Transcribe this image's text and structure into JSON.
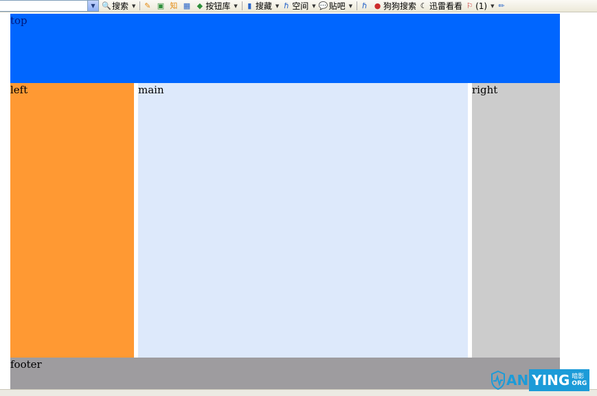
{
  "toolbar": {
    "search_label": "搜索",
    "buttons_label": "按钮库",
    "collect_label": "搜藏",
    "space_label": "空间",
    "tieba_label": "贴吧",
    "sogou_label": "狗狗搜索",
    "xunlei_label": "迅雷看看",
    "count_label": "(1)",
    "zhidao_label": "知"
  },
  "layout": {
    "top_label": "top",
    "left_label": "left",
    "main_label": "main",
    "right_label": "right",
    "footer_label": "footer"
  },
  "watermark": {
    "part1": "AN",
    "part2": "YING",
    "cn": "暗影",
    "org": "ORG"
  },
  "colors": {
    "top": "#0066ff",
    "left": "#ff9933",
    "main": "#dde9fb",
    "right": "#cccccc",
    "footer": "#9e9c9f",
    "watermark": "#1c9bd8"
  }
}
